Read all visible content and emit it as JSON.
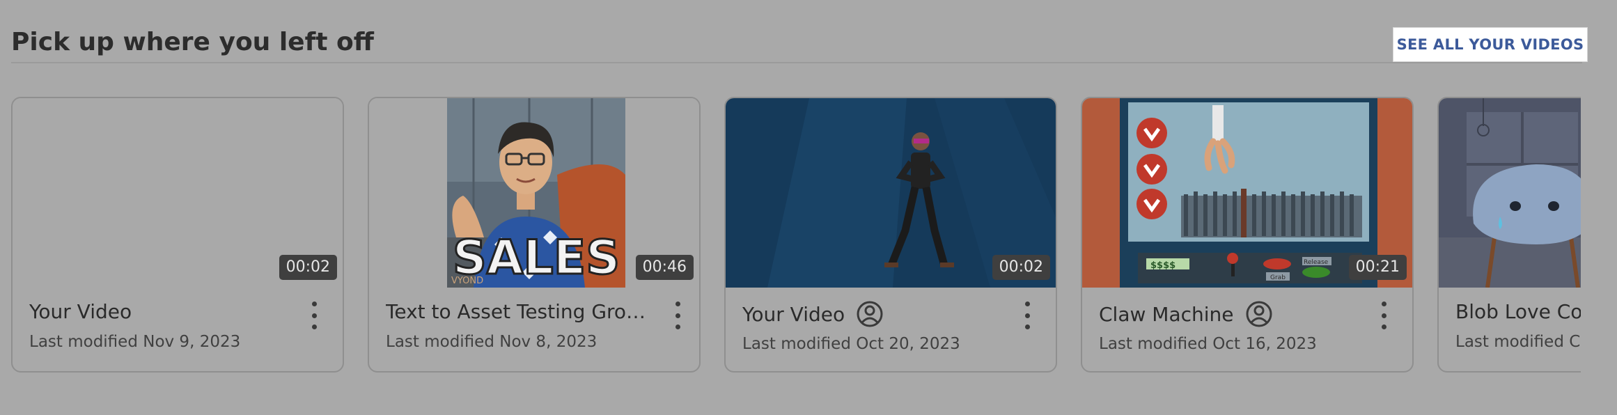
{
  "section": {
    "title": "Pick up where you left off",
    "see_all_label": "SEE ALL YOUR VIDEOS"
  },
  "videos": [
    {
      "title": "Your Video",
      "modified": "Last modified Nov 9, 2023",
      "duration": "00:02",
      "shared_icon": false,
      "thumbnail": "blank"
    },
    {
      "title": "Text to Asset Testing Grou...",
      "modified": "Last modified Nov 8, 2023",
      "duration": "00:46",
      "shared_icon": false,
      "thumbnail": "sales-character",
      "thumb_text": "SALES",
      "watermark": "VYOND"
    },
    {
      "title": "Your Video",
      "modified": "Last modified Oct 20, 2023",
      "duration": "00:02",
      "shared_icon": true,
      "thumbnail": "dancer-blue"
    },
    {
      "title": "Claw Machine",
      "modified": "Last modified Oct 16, 2023",
      "duration": "00:21",
      "shared_icon": true,
      "thumbnail": "claw-machine",
      "thumb_labels": {
        "price": "$$$$",
        "grab": "Grab",
        "release": "Release"
      }
    },
    {
      "title": "Blob Love Co",
      "modified": "Last modified C",
      "duration": "",
      "shared_icon": false,
      "thumbnail": "blob-room"
    }
  ],
  "icons": {
    "owner": "person-circle-icon",
    "more": "kebab-menu-icon"
  },
  "colors": {
    "background": "#a9a9a9",
    "link": "#3c5a9a",
    "badge": "#3f3f3f"
  }
}
